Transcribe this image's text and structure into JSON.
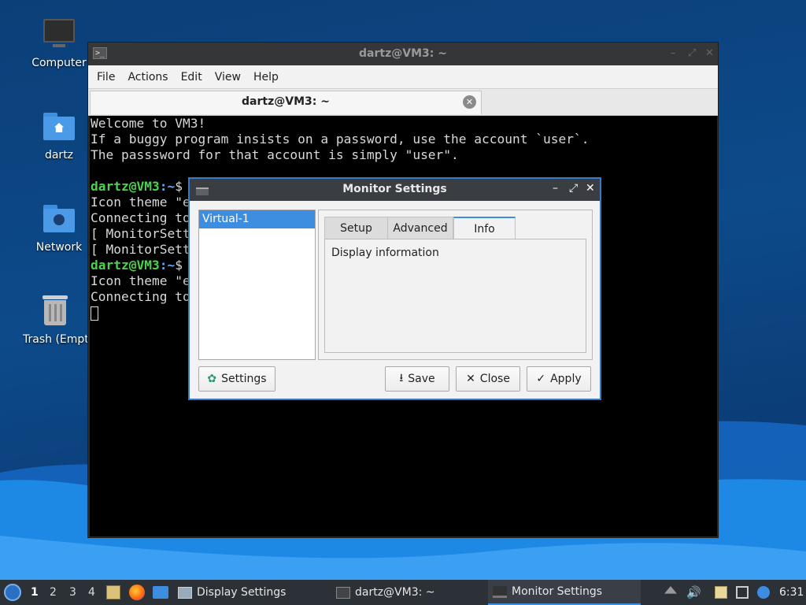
{
  "desktop": {
    "icons": [
      {
        "label": "Computer",
        "icon": "computer-icon"
      },
      {
        "label": "dartz",
        "icon": "home-folder-icon"
      },
      {
        "label": "Network",
        "icon": "network-folder-icon"
      },
      {
        "label": "Trash (Empty)",
        "icon": "trash-icon"
      }
    ]
  },
  "terminal": {
    "title": "dartz@VM3: ~",
    "menu": [
      "File",
      "Actions",
      "Edit",
      "View",
      "Help"
    ],
    "tab_label": "dartz@VM3: ~",
    "lines": [
      "Welcome to VM3!",
      "If a buggy program insists on a password, use the account `user`.",
      "The passsword for that account is simply \"user\".",
      "",
      "Icon theme \"e",
      "Connecting to",
      "[ MonitorSett",
      "[ MonitorSett",
      "Icon theme \"e",
      "Connecting to"
    ],
    "prompt_user": "dartz@VM3",
    "prompt_sep": ":",
    "prompt_path": "~",
    "prompt_symbol": "$"
  },
  "dialog": {
    "title": "Monitor Settings",
    "outputs": [
      "Virtual-1"
    ],
    "tabs": [
      "Setup",
      "Advanced",
      "Info"
    ],
    "active_tab": "Info",
    "info_text": "Display information",
    "buttons": {
      "settings": "Settings",
      "save": "Save",
      "close": "Close",
      "apply": "Apply"
    }
  },
  "taskbar": {
    "workspaces": [
      "1",
      "2",
      "3",
      "4"
    ],
    "tasks": [
      {
        "label": "Display Settings",
        "icon": "display-settings-icon"
      },
      {
        "label": "dartz@VM3: ~",
        "icon": "terminal-icon"
      },
      {
        "label": "Monitor Settings",
        "icon": "monitor-icon"
      }
    ],
    "clock": "6:31"
  },
  "colors": {
    "accent": "#3d8ee0",
    "prompt_user": "#4bd34b",
    "prompt_path": "#5fa8ff"
  }
}
